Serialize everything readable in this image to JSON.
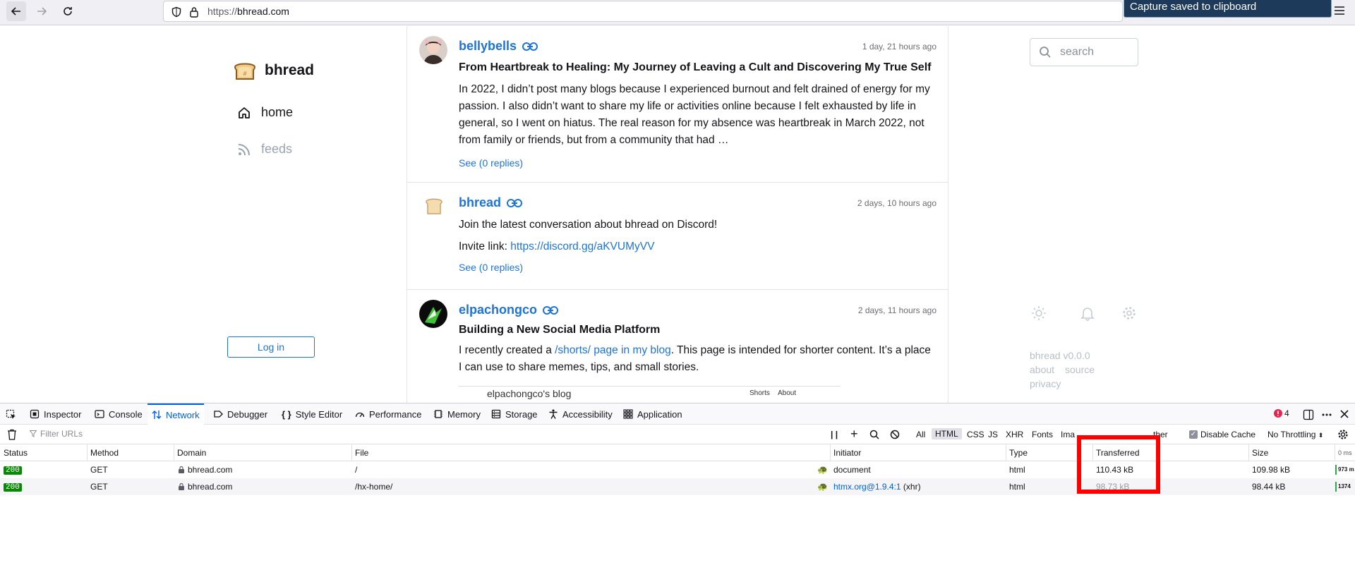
{
  "browser": {
    "url_scheme": "https://",
    "url_host": "bhread.com",
    "toast": "Capture saved to clipboard"
  },
  "site": {
    "title": "bhread",
    "nav": [
      {
        "label": "home",
        "icon": "home-icon"
      },
      {
        "label": "feeds",
        "icon": "rss-icon"
      }
    ],
    "login_label": "Log in",
    "search_placeholder": "search",
    "version": "bhread v0.0.0",
    "footer_links": [
      "about",
      "source",
      "privacy"
    ]
  },
  "posts": [
    {
      "author": "bellybells",
      "time": "1 day, 21 hours ago",
      "title": "From Heartbreak to Healing: My Journey of Leaving a Cult and Discovering My True Self",
      "body": "In 2022, I didn’t post many blogs because I experienced burnout and felt drained of energy for my passion. I also didn’t want to share my life or activities online because I felt exhausted by life in general, so I went on hiatus. The real reason for my absence was heartbreak in March 2022, not from family or friends, but from a community that had …",
      "replies": "See (0 replies)"
    },
    {
      "author": "bhread",
      "time": "2 days, 10 hours ago",
      "line1": "Join the latest conversation about bhread on Discord!",
      "line2_prefix": "Invite link: ",
      "line2_link": "https://discord.gg/aKVUMyVV",
      "replies": "See (0 replies)"
    },
    {
      "author": "elpachongco",
      "time": "2 days, 11 hours ago",
      "title": "Building a New Social Media Platform",
      "body_prefix": "I recently created a ",
      "body_link": "/shorts/ page in my blog",
      "body_suffix": ". This page is intended for shorter content. It’s a place I can use to share memes, tips, and small stories.",
      "embed_title": "elpachongco's blog",
      "embed_links": [
        "Shorts",
        "About"
      ]
    }
  ],
  "devtools": {
    "tabs": [
      "Inspector",
      "Console",
      "Network",
      "Debugger",
      "Style Editor",
      "Performance",
      "Memory",
      "Storage",
      "Accessibility",
      "Application"
    ],
    "active_tab": "Network",
    "error_count": "4",
    "filter_placeholder": "Filter URLs",
    "filter_types": [
      "All",
      "HTML",
      "CSS",
      "JS",
      "XHR",
      "Fonts",
      "Ima",
      "ther"
    ],
    "active_filter": "HTML",
    "disable_cache_label": "Disable Cache",
    "throttling": "No Throttling",
    "columns": [
      "Status",
      "Method",
      "Domain",
      "File",
      "Initiator",
      "Type",
      "Transferred",
      "Size",
      "0 ms"
    ],
    "rows": [
      {
        "status": "200",
        "method": "GET",
        "domain": "bhread.com",
        "file": "/",
        "initiator": "document",
        "initiator_suffix": "",
        "type": "html",
        "transferred": "110.43 kB",
        "size": "109.98 kB",
        "wf": "973 m"
      },
      {
        "status": "200",
        "method": "GET",
        "domain": "bhread.com",
        "file": "/hx-home/",
        "initiator": "htmx.org@1.9.4:1",
        "initiator_suffix": " (xhr)",
        "type": "html",
        "transferred": "98.73 kB",
        "size": "98.44 kB",
        "wf": "1374"
      }
    ]
  },
  "colors": {
    "link": "#1e73d8",
    "status_ok": "#058b00",
    "highlight": "#ff0000"
  }
}
